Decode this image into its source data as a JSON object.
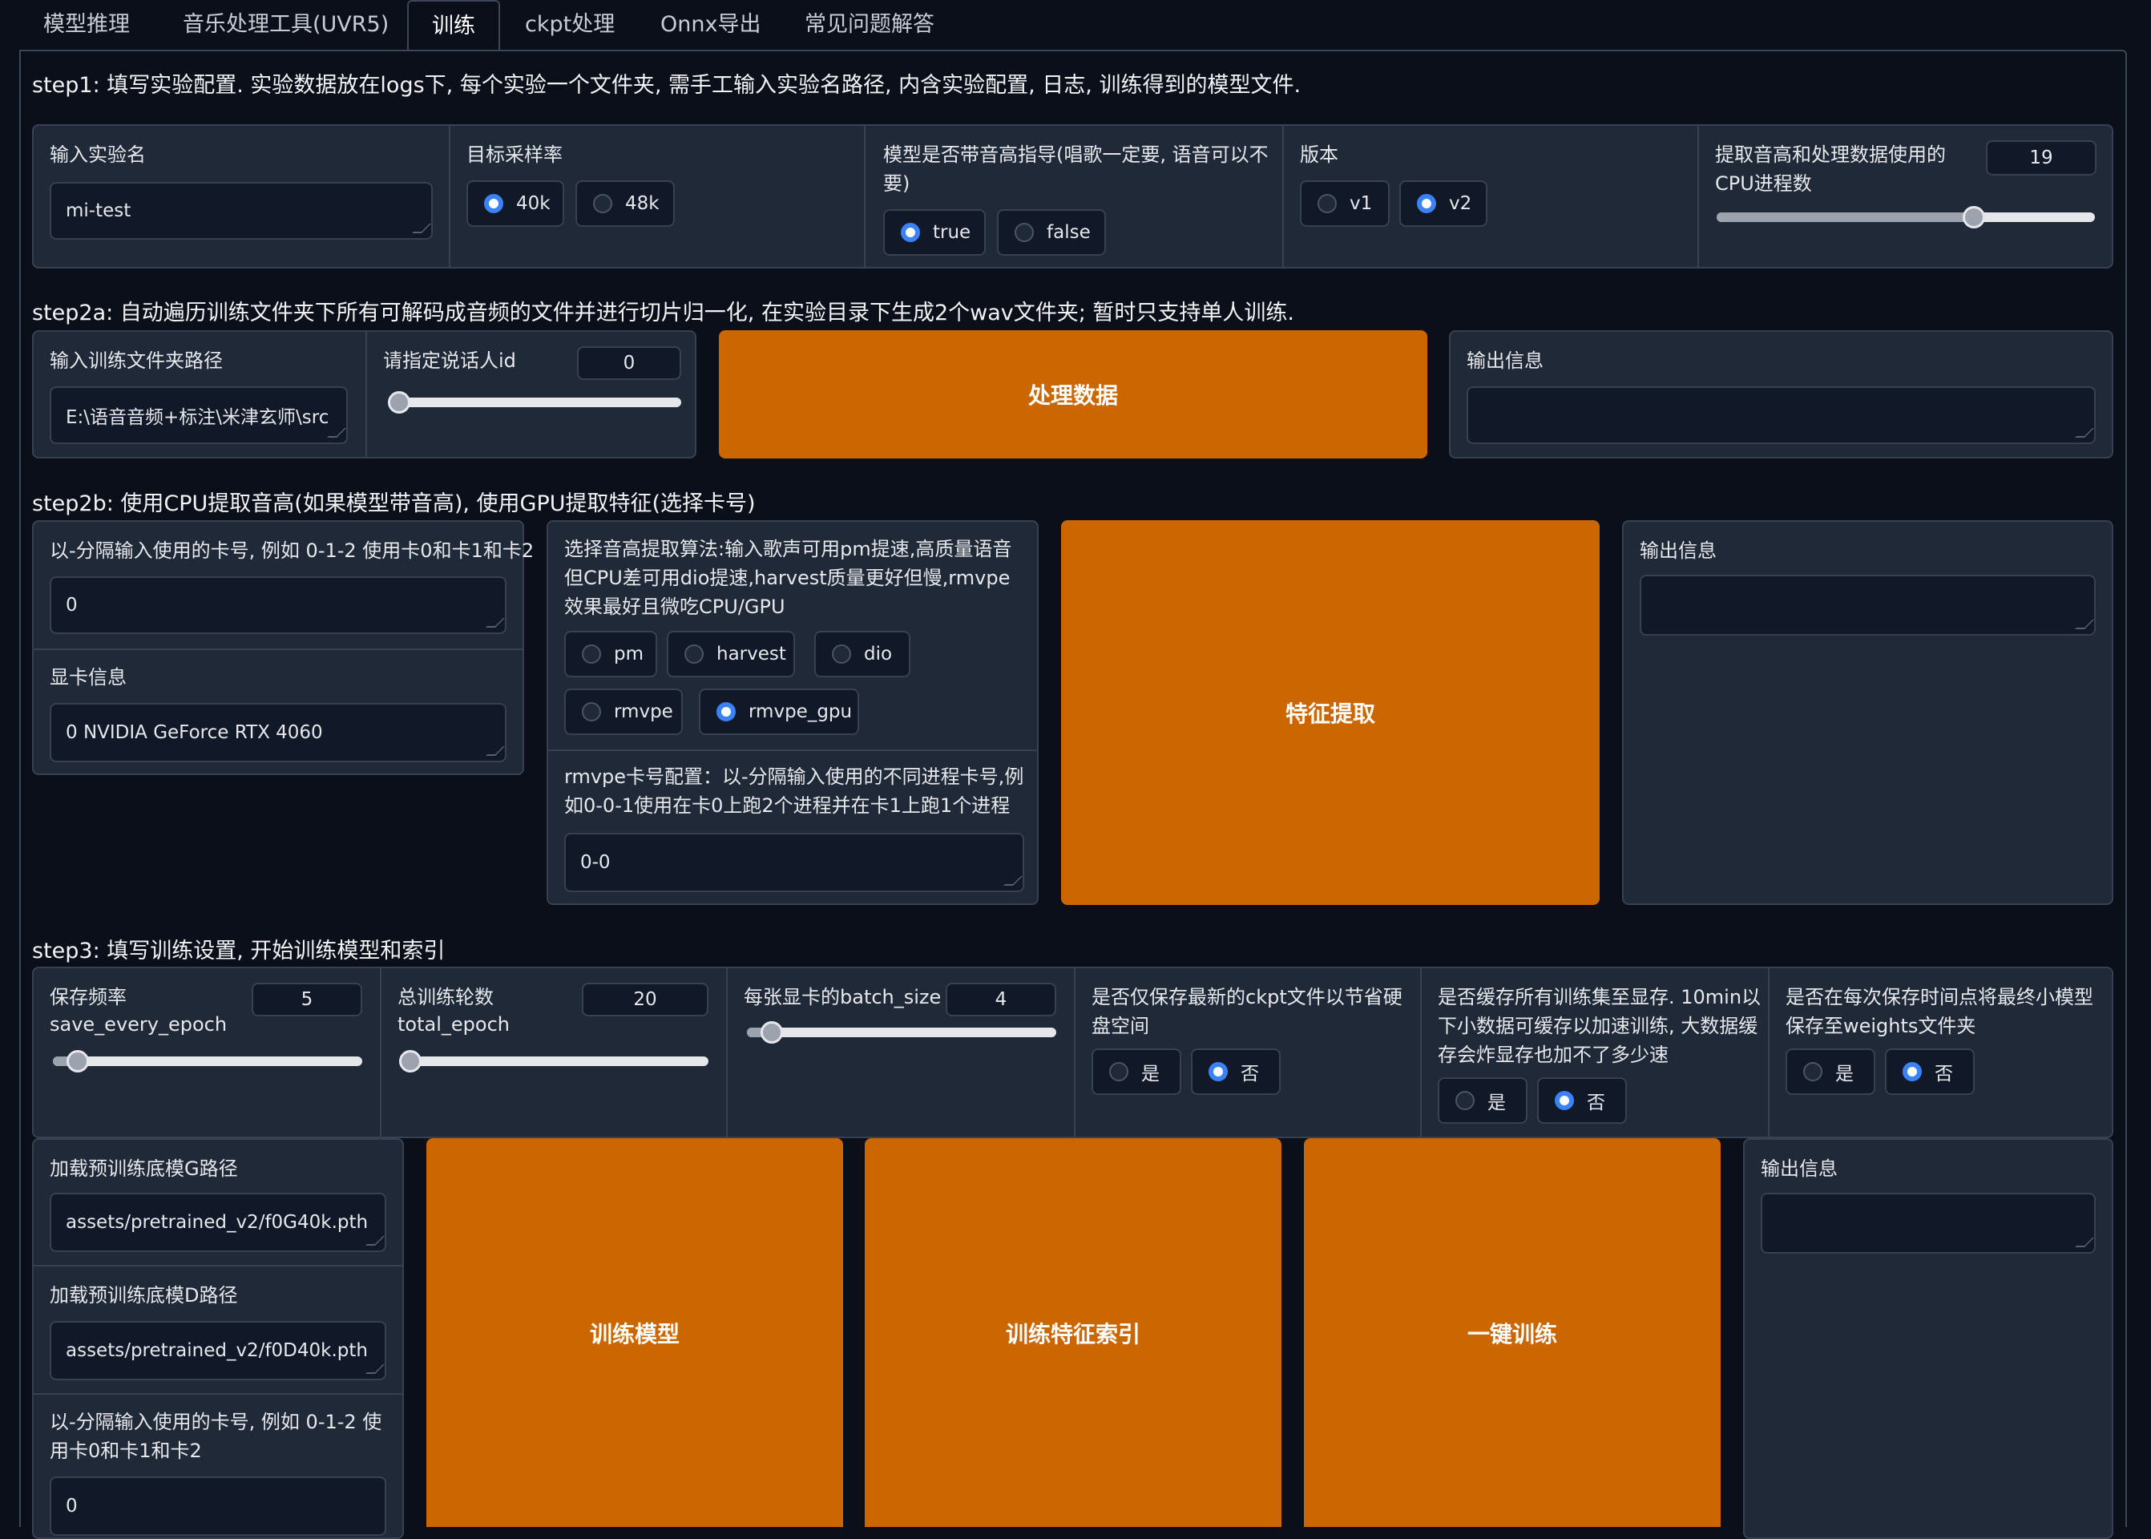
{
  "tabs": [
    "模型推理",
    "音乐处理工具(UVR5)",
    "训练",
    "ckpt处理",
    "Onnx导出",
    "常见问题解答"
  ],
  "active_tab": "训练",
  "step1": {
    "title": "step1: 填写实验配置. 实验数据放在logs下, 每个实验一个文件夹, 需手工输入实验名路径, 内含实验配置, 日志, 训练得到的模型文件.",
    "exp_name_label": "输入实验名",
    "exp_name_value": "mi-test",
    "sr_label": "目标采样率",
    "sr_options": [
      "40k",
      "48k"
    ],
    "sr_selected": "40k",
    "f0_label": "模型是否带音高指导(唱歌一定要, 语音可以不要)",
    "f0_options": [
      "true",
      "false"
    ],
    "f0_selected": "true",
    "version_label": "版本",
    "version_options": [
      "v1",
      "v2"
    ],
    "version_selected": "v2",
    "cpu_label": "提取音高和处理数据使用的CPU进程数",
    "cpu_value": "19",
    "cpu_fraction": 0.68
  },
  "step2a": {
    "title": "step2a: 自动遍历训练文件夹下所有可解码成音频的文件并进行切片归一化, 在实验目录下生成2个wav文件夹; 暂时只支持单人训练.",
    "train_dir_label": "输入训练文件夹路径",
    "train_dir_value": "E:\\语音音频+标注\\米津玄师\\src",
    "speaker_label": "请指定说话人id",
    "speaker_value": "0",
    "speaker_fraction": 0.0,
    "process_button": "处理数据",
    "output_label": "输出信息",
    "output_value": ""
  },
  "step2b": {
    "title": "step2b: 使用CPU提取音高(如果模型带音高), 使用GPU提取特征(选择卡号)",
    "gpus_label": "以-分隔输入使用的卡号, 例如 0-1-2 使用卡0和卡1和卡2",
    "gpus_value": "0",
    "gpu_info_label": "显卡信息",
    "gpu_info_value": "0 NVIDIA GeForce RTX 4060",
    "f0_method_label": "选择音高提取算法:输入歌声可用pm提速,高质量语音但CPU差可用dio提速,harvest质量更好但慢,rmvpe效果最好且微吃CPU/GPU",
    "f0_methods": [
      "pm",
      "harvest",
      "dio",
      "rmvpe",
      "rmvpe_gpu"
    ],
    "f0_method_selected": "rmvpe_gpu",
    "rmvpe_label": "rmvpe卡号配置：以-分隔输入使用的不同进程卡号,例如0-0-1使用在卡0上跑2个进程并在卡1上跑1个进程",
    "rmvpe_value": "0-0",
    "extract_button": "特征提取",
    "output_label": "输出信息",
    "output_value": ""
  },
  "step3": {
    "title": "step3: 填写训练设置, 开始训练模型和索引",
    "save_freq_label": "保存频率",
    "save_freq_sub": "save_every_epoch",
    "save_freq_value": "5",
    "save_freq_fraction": 0.08,
    "total_epoch_label": "总训练轮数",
    "total_epoch_sub": "total_epoch",
    "total_epoch_value": "20",
    "total_epoch_fraction": 0.02,
    "batch_label": "每张显卡的batch_size",
    "batch_value": "4",
    "batch_fraction": 0.08,
    "latest_label": "是否仅保存最新的ckpt文件以节省硬盘空间",
    "latest_options": [
      "是",
      "否"
    ],
    "latest_selected": "否",
    "cache_label": "是否缓存所有训练集至显存. 10min以下小数据可缓存以加速训练, 大数据缓存会炸显存也加不了多少速",
    "cache_options": [
      "是",
      "否"
    ],
    "cache_selected": "否",
    "save_weights_label": "是否在每次保存时间点将最终小模型保存至weights文件夹",
    "save_weights_options": [
      "是",
      "否"
    ],
    "save_weights_selected": "否",
    "pretrained_g_label": "加载预训练底模G路径",
    "pretrained_g_value": "assets/pretrained_v2/f0G40k.pth",
    "pretrained_d_label": "加载预训练底模D路径",
    "pretrained_d_value": "assets/pretrained_v2/f0D40k.pth",
    "gpus_label": "以-分隔输入使用的卡号, 例如 0-1-2 使用卡0和卡1和卡2",
    "gpus_value": "0",
    "train_button": "训练模型",
    "index_button": "训练特征索引",
    "oneclick_button": "一键训练",
    "output_label": "输出信息",
    "output_value": ""
  },
  "colors": {
    "background": "#0b0f19",
    "panel": "#1f2937",
    "border": "#374151",
    "input": "#111827",
    "accent_button": "#cc6600",
    "radio_selected": "#3b82f6"
  }
}
